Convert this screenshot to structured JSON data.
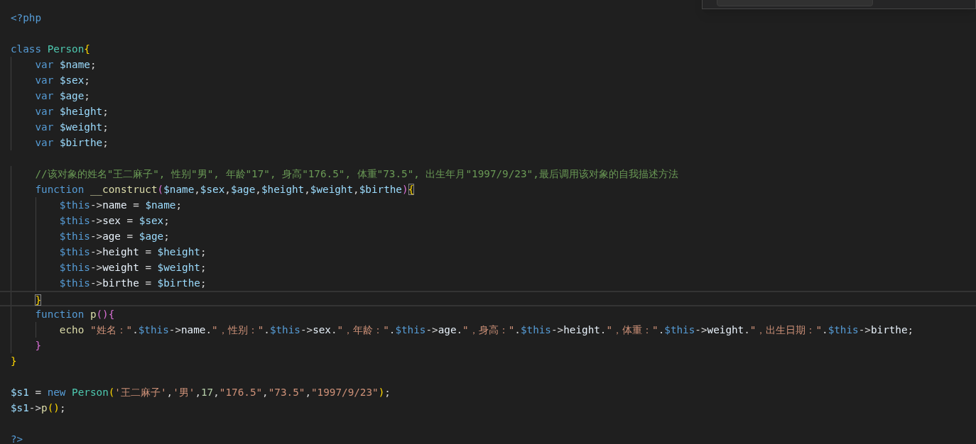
{
  "editor": {
    "lines": [
      {
        "current": false,
        "tokens": [
          {
            "t": "<?php",
            "kind": "tag"
          }
        ]
      },
      {
        "current": false
      },
      {
        "current": false,
        "tokens": [
          {
            "t": "class ",
            "kind": "keyword"
          },
          {
            "t": "Person",
            "kind": "class"
          },
          {
            "t": "{",
            "kind": "bracket1"
          }
        ]
      },
      {
        "current": false,
        "tokens": [
          {
            "t": "    var ",
            "kind": "keyword"
          },
          {
            "t": "$name",
            "kind": "var"
          },
          {
            "t": ";",
            "kind": "plain"
          }
        ]
      },
      {
        "current": false,
        "tokens": [
          {
            "t": "    var ",
            "kind": "keyword"
          },
          {
            "t": "$sex",
            "kind": "var"
          },
          {
            "t": ";",
            "kind": "plain"
          }
        ]
      },
      {
        "current": false,
        "tokens": [
          {
            "t": "    var ",
            "kind": "keyword"
          },
          {
            "t": "$age",
            "kind": "var"
          },
          {
            "t": ";",
            "kind": "plain"
          }
        ]
      },
      {
        "current": false,
        "tokens": [
          {
            "t": "    var ",
            "kind": "keyword"
          },
          {
            "t": "$height",
            "kind": "var"
          },
          {
            "t": ";",
            "kind": "plain"
          }
        ]
      },
      {
        "current": false,
        "tokens": [
          {
            "t": "    var ",
            "kind": "keyword"
          },
          {
            "t": "$weight",
            "kind": "var"
          },
          {
            "t": ";",
            "kind": "plain"
          }
        ]
      },
      {
        "current": false,
        "tokens": [
          {
            "t": "    var ",
            "kind": "keyword"
          },
          {
            "t": "$birthe",
            "kind": "var"
          },
          {
            "t": ";",
            "kind": "plain"
          }
        ]
      },
      {
        "current": false
      },
      {
        "current": false,
        "tokens": [
          {
            "t": "    //该对象的姓名\"王二麻子\", 性别\"男\", 年龄\"17\", 身高\"176.5\", 体重\"73.5\", 出生年月\"1997/9/23\",最后调用该对象的自我描述方法",
            "kind": "comment"
          }
        ]
      },
      {
        "current": false,
        "tokens": [
          {
            "t": "    function ",
            "kind": "keyword"
          },
          {
            "t": "__construct",
            "kind": "func"
          },
          {
            "t": "(",
            "kind": "bracket2"
          },
          {
            "t": "$name",
            "kind": "var"
          },
          {
            "t": ",",
            "kind": "plain"
          },
          {
            "t": "$sex",
            "kind": "var"
          },
          {
            "t": ",",
            "kind": "plain"
          },
          {
            "t": "$age",
            "kind": "var"
          },
          {
            "t": ",",
            "kind": "plain"
          },
          {
            "t": "$height",
            "kind": "var"
          },
          {
            "t": ",",
            "kind": "plain"
          },
          {
            "t": "$weight",
            "kind": "var"
          },
          {
            "t": ",",
            "kind": "plain"
          },
          {
            "t": "$birthe",
            "kind": "var"
          },
          {
            "t": ")",
            "kind": "bracket2"
          },
          {
            "t": "{",
            "kind": "match"
          }
        ]
      },
      {
        "current": false,
        "tokens": [
          {
            "t": "        $this",
            "kind": "this"
          },
          {
            "t": "->",
            "kind": "plain"
          },
          {
            "t": "name",
            "kind": "prop"
          },
          {
            "t": " = ",
            "kind": "plain"
          },
          {
            "t": "$name",
            "kind": "var"
          },
          {
            "t": ";",
            "kind": "plain"
          }
        ]
      },
      {
        "current": false,
        "tokens": [
          {
            "t": "        $this",
            "kind": "this"
          },
          {
            "t": "->",
            "kind": "plain"
          },
          {
            "t": "sex",
            "kind": "prop"
          },
          {
            "t": " = ",
            "kind": "plain"
          },
          {
            "t": "$sex",
            "kind": "var"
          },
          {
            "t": ";",
            "kind": "plain"
          }
        ]
      },
      {
        "current": false,
        "tokens": [
          {
            "t": "        $this",
            "kind": "this"
          },
          {
            "t": "->",
            "kind": "plain"
          },
          {
            "t": "age",
            "kind": "prop"
          },
          {
            "t": " = ",
            "kind": "plain"
          },
          {
            "t": "$age",
            "kind": "var"
          },
          {
            "t": ";",
            "kind": "plain"
          }
        ]
      },
      {
        "current": false,
        "tokens": [
          {
            "t": "        $this",
            "kind": "this"
          },
          {
            "t": "->",
            "kind": "plain"
          },
          {
            "t": "height",
            "kind": "prop"
          },
          {
            "t": " = ",
            "kind": "plain"
          },
          {
            "t": "$height",
            "kind": "var"
          },
          {
            "t": ";",
            "kind": "plain"
          }
        ]
      },
      {
        "current": false,
        "tokens": [
          {
            "t": "        $this",
            "kind": "this"
          },
          {
            "t": "->",
            "kind": "plain"
          },
          {
            "t": "weight",
            "kind": "prop"
          },
          {
            "t": " = ",
            "kind": "plain"
          },
          {
            "t": "$weight",
            "kind": "var"
          },
          {
            "t": ";",
            "kind": "plain"
          }
        ]
      },
      {
        "current": false,
        "tokens": [
          {
            "t": "        $this",
            "kind": "this"
          },
          {
            "t": "->",
            "kind": "plain"
          },
          {
            "t": "birthe",
            "kind": "prop"
          },
          {
            "t": " = ",
            "kind": "plain"
          },
          {
            "t": "$birthe",
            "kind": "var"
          },
          {
            "t": ";",
            "kind": "plain"
          }
        ]
      },
      {
        "current": true,
        "tokens": [
          {
            "t": "    }",
            "kind": "match"
          }
        ]
      },
      {
        "current": false,
        "tokens": [
          {
            "t": "    function ",
            "kind": "keyword"
          },
          {
            "t": "p",
            "kind": "func"
          },
          {
            "t": "()",
            "kind": "bracket2"
          },
          {
            "t": "{",
            "kind": "bracket2"
          }
        ]
      },
      {
        "current": false,
        "tokens": [
          {
            "t": "        echo ",
            "kind": "func"
          },
          {
            "t": "\"姓名：\"",
            "kind": "string"
          },
          {
            "t": ".",
            "kind": "plain"
          },
          {
            "t": "$this",
            "kind": "this"
          },
          {
            "t": "->",
            "kind": "plain"
          },
          {
            "t": "name",
            "kind": "prop"
          },
          {
            "t": ".",
            "kind": "plain"
          },
          {
            "t": "\"，性别：\"",
            "kind": "string"
          },
          {
            "t": ".",
            "kind": "plain"
          },
          {
            "t": "$this",
            "kind": "this"
          },
          {
            "t": "->",
            "kind": "plain"
          },
          {
            "t": "sex",
            "kind": "prop"
          },
          {
            "t": ".",
            "kind": "plain"
          },
          {
            "t": "\"，年龄：\"",
            "kind": "string"
          },
          {
            "t": ".",
            "kind": "plain"
          },
          {
            "t": "$this",
            "kind": "this"
          },
          {
            "t": "->",
            "kind": "plain"
          },
          {
            "t": "age",
            "kind": "prop"
          },
          {
            "t": ".",
            "kind": "plain"
          },
          {
            "t": "\"，身高：\"",
            "kind": "string"
          },
          {
            "t": ".",
            "kind": "plain"
          },
          {
            "t": "$this",
            "kind": "this"
          },
          {
            "t": "->",
            "kind": "plain"
          },
          {
            "t": "height",
            "kind": "prop"
          },
          {
            "t": ".",
            "kind": "plain"
          },
          {
            "t": "\"，体重：\"",
            "kind": "string"
          },
          {
            "t": ".",
            "kind": "plain"
          },
          {
            "t": "$this",
            "kind": "this"
          },
          {
            "t": "->",
            "kind": "plain"
          },
          {
            "t": "weight",
            "kind": "prop"
          },
          {
            "t": ".",
            "kind": "plain"
          },
          {
            "t": "\"，出生日期：\"",
            "kind": "string"
          },
          {
            "t": ".",
            "kind": "plain"
          },
          {
            "t": "$this",
            "kind": "this"
          },
          {
            "t": "->",
            "kind": "plain"
          },
          {
            "t": "birthe",
            "kind": "prop"
          },
          {
            "t": ";",
            "kind": "plain"
          }
        ]
      },
      {
        "current": false,
        "tokens": [
          {
            "t": "    }",
            "kind": "bracket2"
          }
        ]
      },
      {
        "current": false,
        "tokens": [
          {
            "t": "}",
            "kind": "bracket1"
          }
        ]
      },
      {
        "current": false
      },
      {
        "current": false,
        "tokens": [
          {
            "t": "$s1",
            "kind": "var"
          },
          {
            "t": " = ",
            "kind": "plain"
          },
          {
            "t": "new ",
            "kind": "keyword"
          },
          {
            "t": "Person",
            "kind": "class"
          },
          {
            "t": "(",
            "kind": "bracket1"
          },
          {
            "t": "'王二麻子'",
            "kind": "string"
          },
          {
            "t": ",",
            "kind": "plain"
          },
          {
            "t": "'男'",
            "kind": "string"
          },
          {
            "t": ",",
            "kind": "plain"
          },
          {
            "t": "17",
            "kind": "number"
          },
          {
            "t": ",",
            "kind": "plain"
          },
          {
            "t": "\"176.5\"",
            "kind": "string"
          },
          {
            "t": ",",
            "kind": "plain"
          },
          {
            "t": "\"73.5\"",
            "kind": "string"
          },
          {
            "t": ",",
            "kind": "plain"
          },
          {
            "t": "\"1997/9/23\"",
            "kind": "string"
          },
          {
            "t": ")",
            "kind": "bracket1"
          },
          {
            "t": ";",
            "kind": "plain"
          }
        ]
      },
      {
        "current": false,
        "tokens": [
          {
            "t": "$s1",
            "kind": "var"
          },
          {
            "t": "->",
            "kind": "plain"
          },
          {
            "t": "p",
            "kind": "func"
          },
          {
            "t": "()",
            "kind": "bracket1"
          },
          {
            "t": ";",
            "kind": "plain"
          }
        ]
      },
      {
        "current": false
      },
      {
        "current": false,
        "tokens": [
          {
            "t": "?>",
            "kind": "tag"
          }
        ]
      }
    ]
  }
}
